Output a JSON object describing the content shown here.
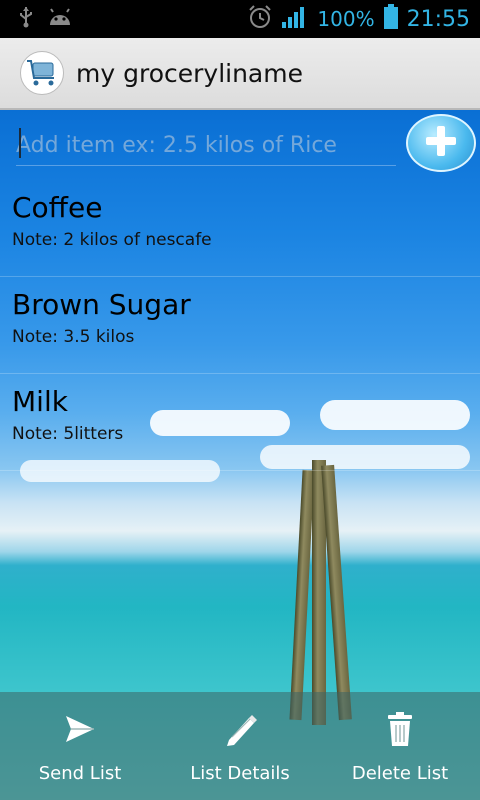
{
  "status_bar": {
    "battery_percent": "100%",
    "time": "21:55",
    "icons": [
      "usb-icon",
      "android-icon",
      "alarm-icon",
      "signal-icon",
      "battery-icon"
    ]
  },
  "action_bar": {
    "title": "my groceryliname",
    "logo_icon": "shopping-cart-icon"
  },
  "add_item": {
    "placeholder": "Add item ex: 2.5 kilos of Rice",
    "value": ""
  },
  "items": [
    {
      "name": "Coffee",
      "note": "Note: 2 kilos of nescafe"
    },
    {
      "name": "Brown Sugar",
      "note": "Note: 3.5 kilos"
    },
    {
      "name": "Milk",
      "note": "Note: 5litters"
    }
  ],
  "bottom_bar": {
    "send": "Send List",
    "details": "List Details",
    "delete": "Delete List"
  },
  "colors": {
    "status_accent": "#33b5e5",
    "action_bar": "#e5e5e5"
  }
}
